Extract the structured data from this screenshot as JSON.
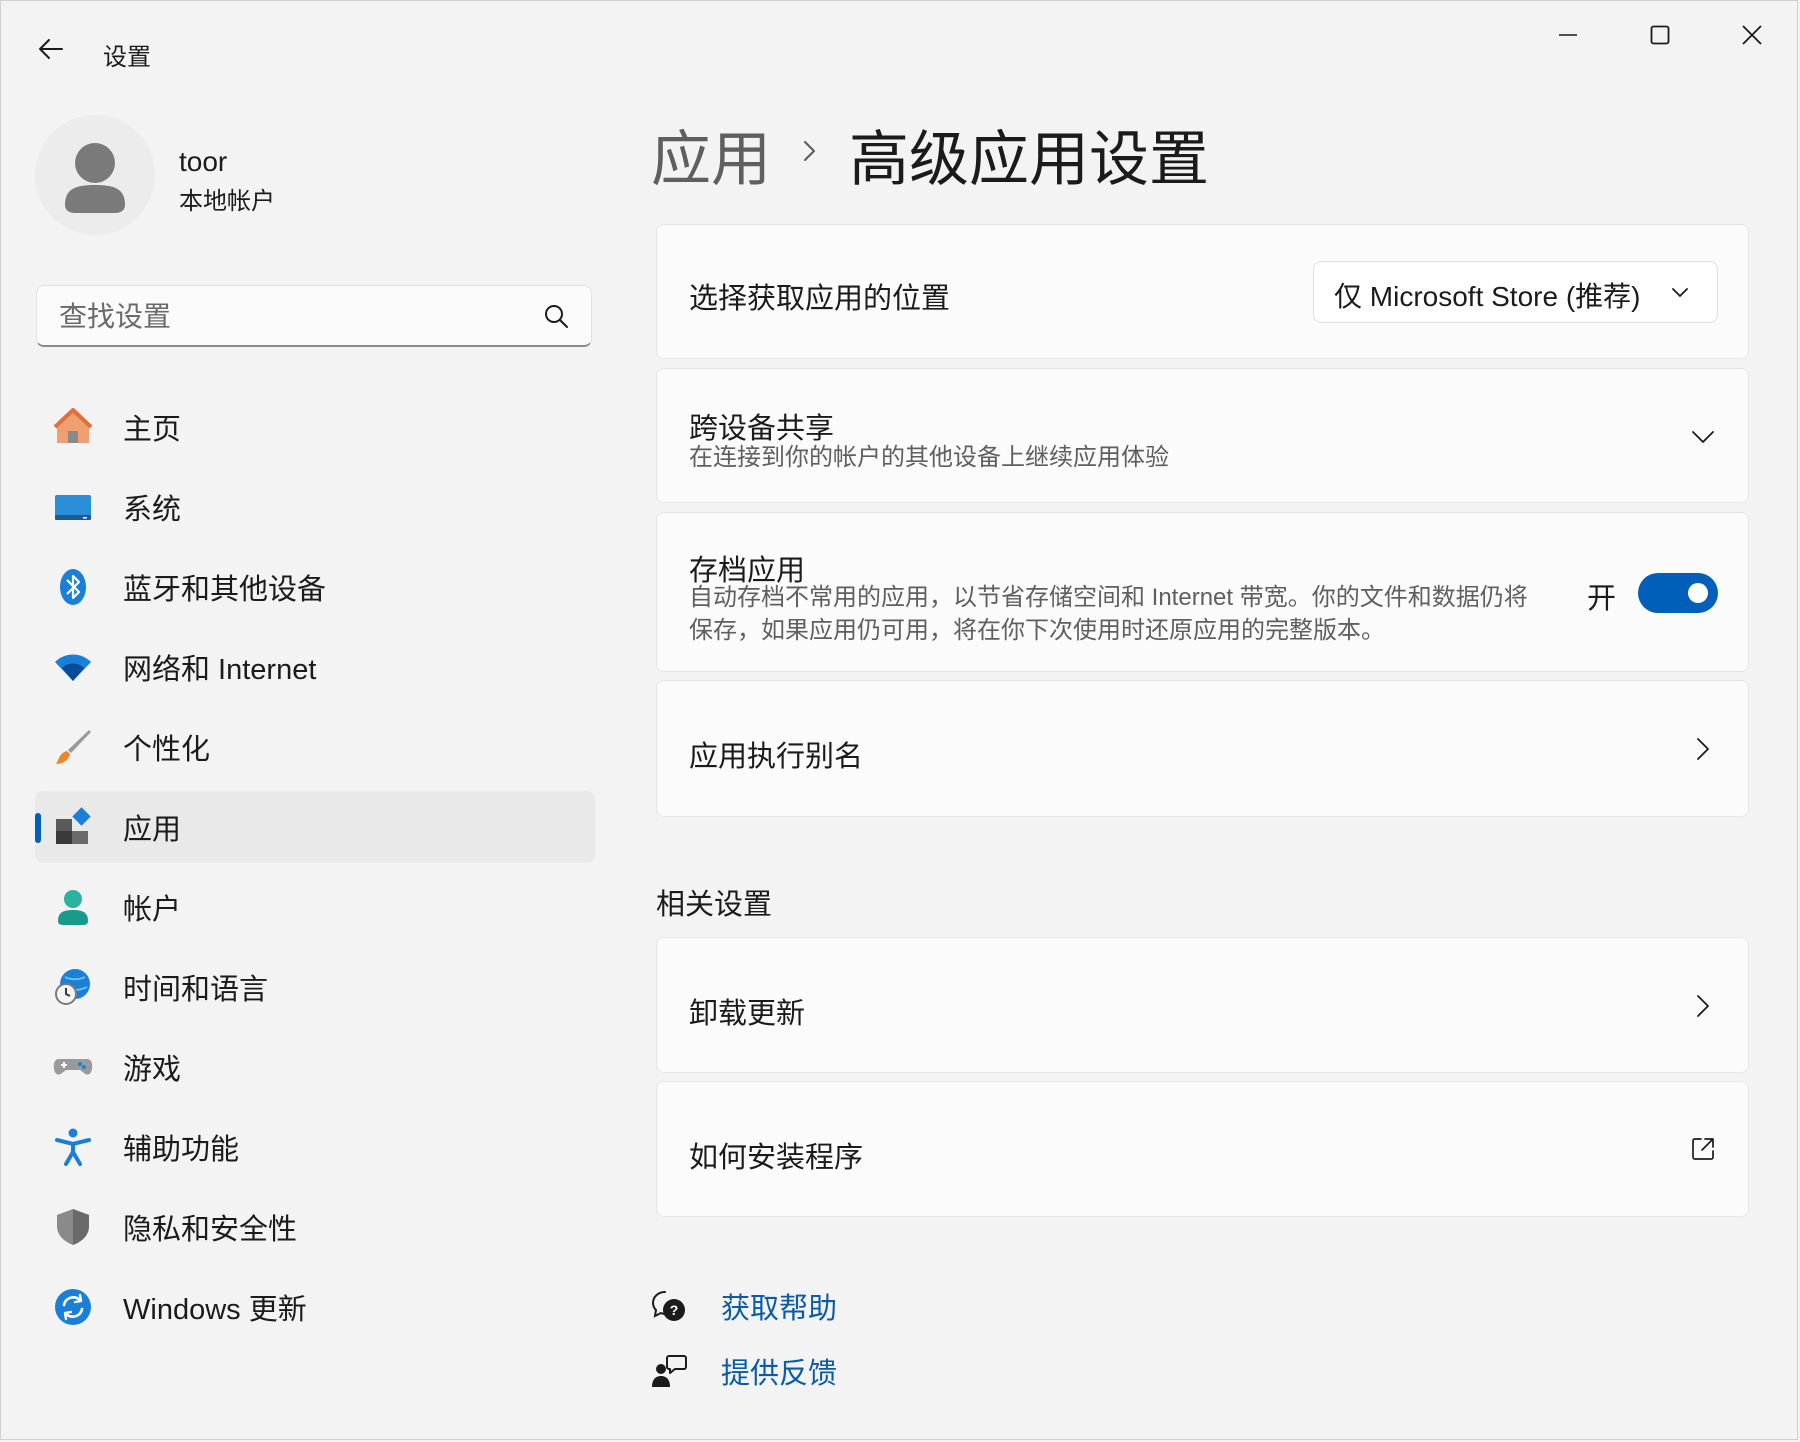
{
  "window": {
    "title": "设置",
    "controls": [
      "minimize-icon",
      "maximize-icon",
      "close-icon"
    ]
  },
  "profile": {
    "name": "toor",
    "account_type": "本地帐户"
  },
  "search": {
    "placeholder": "查找设置",
    "value": ""
  },
  "sidebar": {
    "items": [
      {
        "label": "主页",
        "icon": "home-icon"
      },
      {
        "label": "系统",
        "icon": "system-display-icon"
      },
      {
        "label": "蓝牙和其他设备",
        "icon": "bluetooth-icon"
      },
      {
        "label": "网络和 Internet",
        "icon": "wifi-icon"
      },
      {
        "label": "个性化",
        "icon": "paintbrush-icon"
      },
      {
        "label": "应用",
        "icon": "apps-icon",
        "selected": true
      },
      {
        "label": "帐户",
        "icon": "account-icon"
      },
      {
        "label": "时间和语言",
        "icon": "globe-clock-icon"
      },
      {
        "label": "游戏",
        "icon": "gamepad-icon"
      },
      {
        "label": "辅助功能",
        "icon": "accessibility-icon"
      },
      {
        "label": "隐私和安全性",
        "icon": "shield-icon"
      },
      {
        "label": "Windows 更新",
        "icon": "update-sync-icon"
      }
    ],
    "accent_color": "#005fb8"
  },
  "breadcrumb": {
    "parent": "应用",
    "current": "高级应用设置"
  },
  "settings": {
    "app_source": {
      "title": "选择获取应用的位置",
      "selected": "仅 Microsoft Store (推荐)"
    },
    "cross_device": {
      "title": "跨设备共享",
      "description": "在连接到你的帐户的其他设备上继续应用体验"
    },
    "archive_apps": {
      "title": "存档应用",
      "description_line1": "自动存档不常用的应用，以节省存储空间和 Internet 带宽。你的文件和数据仍将",
      "description_line2": "保存，如果应用仍可用，将在你下次使用时还原应用的完整版本。",
      "state_label": "开",
      "enabled": true
    },
    "execution_alias": {
      "title": "应用执行别名"
    }
  },
  "related": {
    "heading": "相关设置",
    "uninstall_updates": "卸载更新",
    "how_to_install": "如何安装程序"
  },
  "help": {
    "get_help": "获取帮助",
    "give_feedback": "提供反馈"
  }
}
